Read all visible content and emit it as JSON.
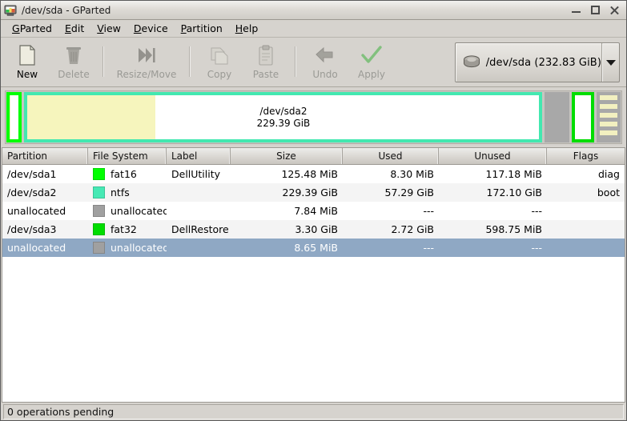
{
  "window": {
    "title": "/dev/sda - GParted",
    "icon": "gparted-monitor-icon",
    "minimize_label": "Minimize",
    "maximize_label": "Maximize",
    "close_label": "Close"
  },
  "menubar": {
    "items": [
      {
        "label": "GParted",
        "mnemonic": "G"
      },
      {
        "label": "Edit",
        "mnemonic": "E"
      },
      {
        "label": "View",
        "mnemonic": "V"
      },
      {
        "label": "Device",
        "mnemonic": "D"
      },
      {
        "label": "Partition",
        "mnemonic": "P"
      },
      {
        "label": "Help",
        "mnemonic": "H"
      }
    ]
  },
  "toolbar": {
    "buttons": [
      {
        "label": "New",
        "icon": "new-document-icon",
        "enabled": true
      },
      {
        "label": "Delete",
        "icon": "trash-can-icon",
        "enabled": false
      },
      {
        "label": "Resize/Move",
        "icon": "resize-move-icon",
        "enabled": false
      },
      {
        "label": "Copy",
        "icon": "copy-icon",
        "enabled": false
      },
      {
        "label": "Paste",
        "icon": "clipboard-paste-icon",
        "enabled": false
      },
      {
        "label": "Undo",
        "icon": "undo-arrow-icon",
        "enabled": false
      },
      {
        "label": "Apply",
        "icon": "apply-check-icon",
        "enabled": false
      }
    ]
  },
  "device_selector": {
    "icon": "hard-disk-icon",
    "label": "/dev/sda  (232.83 GiB)",
    "dropdown_icon": "chevron-down-icon"
  },
  "disk_graphic": {
    "segments": [
      {
        "name": "/dev/sda1",
        "filesystem": "fat16",
        "border_color": "#00ff00",
        "fill_color": "#ffffff",
        "used_color": "#f6f5bd",
        "used_percent": 7,
        "width_percent": 1.6,
        "text_line1": "",
        "text_line2": "",
        "show_text": false,
        "hatched": false
      },
      {
        "name": "/dev/sda2",
        "filesystem": "ntfs",
        "border_color": "#43e8b0",
        "fill_color": "#ffffff",
        "used_color": "#f6f5bd",
        "used_percent": 25,
        "width_percent": 89.0,
        "text_line1": "/dev/sda2",
        "text_line2": "229.39 GiB",
        "show_text": true,
        "hatched": false
      },
      {
        "name": "unallocated",
        "filesystem": "unallocated",
        "border_color": "#a8a8a8",
        "fill_color": "#a8a8a8",
        "used_color": "",
        "used_percent": 0,
        "width_percent": 3.2,
        "text_line1": "",
        "text_line2": "",
        "show_text": false,
        "hatched": false
      },
      {
        "name": "/dev/sda3",
        "filesystem": "fat32",
        "border_color": "#00dd00",
        "fill_color": "#ffffff",
        "used_color": "#f6f5bd",
        "used_percent": 0,
        "width_percent": 2.8,
        "text_line1": "",
        "text_line2": "",
        "show_text": false,
        "hatched": false
      },
      {
        "name": "unallocated",
        "filesystem": "unallocated",
        "border_color": "#a8a8a8",
        "fill_color": "#a8a8a8",
        "used_color": "",
        "used_percent": 0,
        "width_percent": 3.0,
        "text_line1": "",
        "text_line2": "",
        "show_text": false,
        "hatched": true,
        "hatch_color": "#f2f0c0",
        "selected": true
      }
    ]
  },
  "table": {
    "columns": [
      {
        "key": "partition",
        "label": "Partition",
        "align": "left"
      },
      {
        "key": "filesystem",
        "label": "File System",
        "align": "left"
      },
      {
        "key": "label",
        "label": "Label",
        "align": "left"
      },
      {
        "key": "size",
        "label": "Size",
        "align": "center"
      },
      {
        "key": "used",
        "label": "Used",
        "align": "center"
      },
      {
        "key": "unused",
        "label": "Unused",
        "align": "center"
      },
      {
        "key": "flags",
        "label": "Flags",
        "align": "center"
      }
    ],
    "rows": [
      {
        "partition": "/dev/sda1",
        "filesystem": "fat16",
        "fs_color": "#00ff00",
        "label": "DellUtility",
        "size": "125.48 MiB",
        "used": "8.30 MiB",
        "unused": "117.18 MiB",
        "flags": "diag",
        "selected": false
      },
      {
        "partition": "/dev/sda2",
        "filesystem": "ntfs",
        "fs_color": "#46e9b4",
        "label": "",
        "size": "229.39 GiB",
        "used": "57.29 GiB",
        "unused": "172.10 GiB",
        "flags": "boot",
        "selected": false
      },
      {
        "partition": "unallocated",
        "filesystem": "unallocated",
        "fs_color": "#a0a0a0",
        "label": "",
        "size": "7.84 MiB",
        "used": "---",
        "unused": "---",
        "flags": "",
        "selected": false
      },
      {
        "partition": "/dev/sda3",
        "filesystem": "fat32",
        "fs_color": "#00dd00",
        "label": "DellRestore",
        "size": "3.30 GiB",
        "used": "2.72 GiB",
        "unused": "598.75 MiB",
        "flags": "",
        "selected": false
      },
      {
        "partition": "unallocated",
        "filesystem": "unallocated",
        "fs_color": "#a0a0a0",
        "label": "",
        "size": "8.65 MiB",
        "used": "---",
        "unused": "---",
        "flags": "",
        "selected": true
      }
    ]
  },
  "statusbar": {
    "text": "0 operations pending"
  },
  "colors": {
    "selection": "#8fa8c4",
    "window_bg": "#d6d3ce",
    "fat16": "#00ff00",
    "fat32": "#00dd00",
    "ntfs": "#46e9b4",
    "unallocated": "#a0a0a0",
    "used_fill": "#f6f5bd"
  }
}
